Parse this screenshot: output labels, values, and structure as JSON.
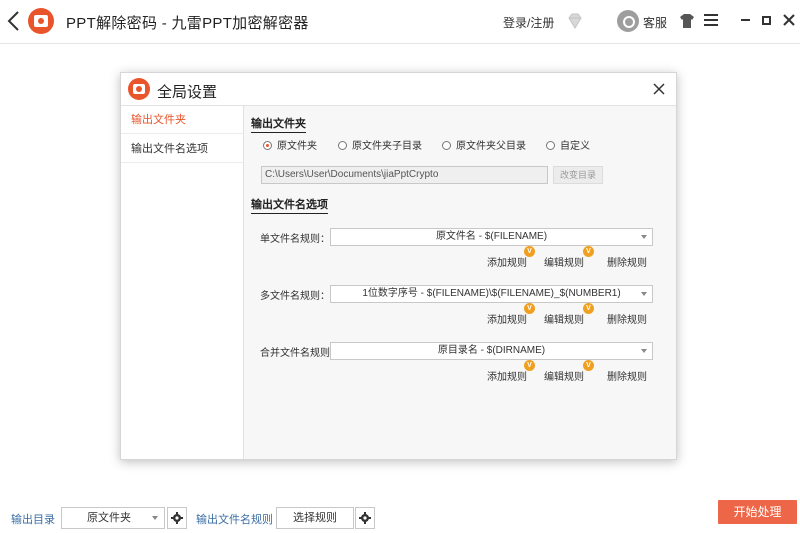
{
  "titlebar": {
    "title": "PPT解除密码 - 九雷PPT加密解密器",
    "login_label": "登录/注册",
    "support_label": "客服",
    "icons": [
      "back-arrow-icon",
      "app-logo",
      "vip-diamond-icon",
      "headset-icon",
      "tshirt-skin-icon",
      "menu-icon",
      "minimize-icon",
      "maximize-icon",
      "close-icon"
    ]
  },
  "dialog": {
    "title": "全局设置",
    "sidebar": [
      {
        "label": "输出文件夹",
        "active": true
      },
      {
        "label": "输出文件名选项",
        "active": false
      }
    ],
    "output_folder": {
      "section_title": "输出文件夹",
      "options": [
        {
          "label": "原文件夹",
          "checked": true
        },
        {
          "label": "原文件夹子目录",
          "checked": false
        },
        {
          "label": "原文件夹父目录",
          "checked": false
        },
        {
          "label": "自定义",
          "checked": false
        }
      ],
      "path_value": "C:\\Users\\User\\Documents\\jiaPptCrypto",
      "change_dir_label": "改变目录"
    },
    "filename_options": {
      "section_title": "输出文件名选项",
      "rules": [
        {
          "label": "单文件名规则：",
          "value": "原文件名 - $(FILENAME)"
        },
        {
          "label": "多文件名规则：",
          "value": "1位数字序号 - $(FILENAME)\\$(FILENAME)_$(NUMBER1)"
        },
        {
          "label": "合并文件名规则：",
          "value": "原目录名 - $(DIRNAME)"
        }
      ],
      "actions": {
        "add": "添加规则",
        "edit": "编辑规则",
        "delete": "删除规则",
        "badge": "V"
      }
    }
  },
  "bottom": {
    "output_dir_label": "输出目录",
    "output_dir_value": "原文件夹",
    "filename_rule_label": "输出文件名规则",
    "choose_rule_label": "选择规则",
    "start_label": "开始处理"
  },
  "colors": {
    "accent": "#e9542b",
    "start_button": "#ee6648",
    "badge": "#f0a020",
    "link": "#3a6ea5"
  }
}
